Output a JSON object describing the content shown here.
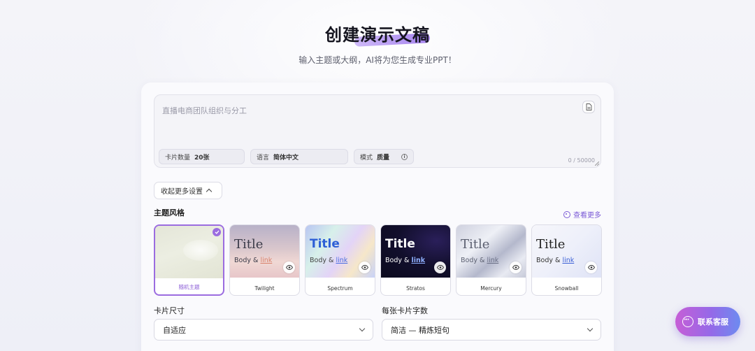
{
  "hero": {
    "title": "创建演示文稿",
    "subtitle": "输入主题或大纲，AI将为您生成专业PPT！"
  },
  "prompt": {
    "value": "直播电商团队组织与分工",
    "counter": "0 / 50000",
    "chips": {
      "cards_label": "卡片数量",
      "cards_value": "20张",
      "lang_label": "语言",
      "lang_value": "简体中文",
      "mode_label": "模式",
      "mode_value": "质量"
    }
  },
  "settings": {
    "collapse_label": "收起更多设置",
    "theme_section": "主题风格",
    "see_more": "查看更多",
    "card_size_label": "卡片尺寸",
    "card_size_value": "自适应",
    "words_label": "每张卡片字数",
    "words_value": "简洁 — 精炼短句"
  },
  "themes": [
    {
      "name": "随机主题",
      "selected": true
    },
    {
      "name": "Twilight",
      "title": "Title",
      "body": "Body &",
      "link": "link"
    },
    {
      "name": "Spectrum",
      "title": "Title",
      "body": "Body &",
      "link": "link"
    },
    {
      "name": "Stratos",
      "title": "Title",
      "body": "Body &",
      "link": "link"
    },
    {
      "name": "Mercury",
      "title": "Title",
      "body": "Body &",
      "link": "link"
    },
    {
      "name": "Snowball",
      "title": "Title",
      "body": "Body &",
      "link": "link"
    }
  ],
  "support": {
    "label": "联系客服"
  },
  "colors": {
    "accent": "#9b6ce0",
    "link": "#7b5bd6"
  }
}
